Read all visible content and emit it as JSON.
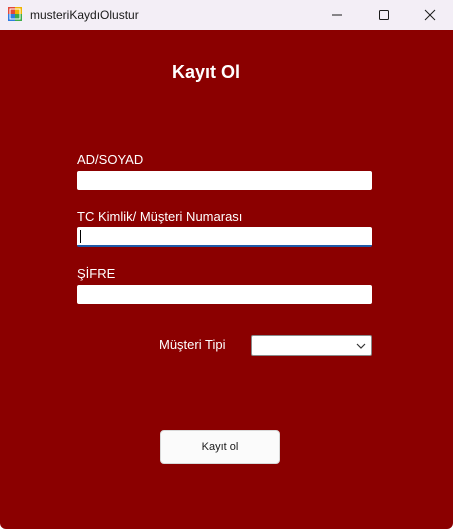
{
  "window": {
    "title": "musteriKaydıOlustur",
    "controls": {
      "minimize_icon": "minimize-icon",
      "maximize_icon": "maximize-icon",
      "close_icon": "close-icon"
    },
    "background_color": "#8b0000"
  },
  "form": {
    "heading": "Kayıt Ol",
    "fields": {
      "name_label": "AD/SOYAD",
      "name_value": "",
      "tc_label": "TC Kimlik/ Müşteri Numarası",
      "tc_value": "",
      "password_label": "ŞİFRE",
      "password_value": ""
    },
    "customer_type": {
      "label": "Müşteri Tipi",
      "selected": ""
    },
    "submit_label": "Kayıt ol"
  }
}
